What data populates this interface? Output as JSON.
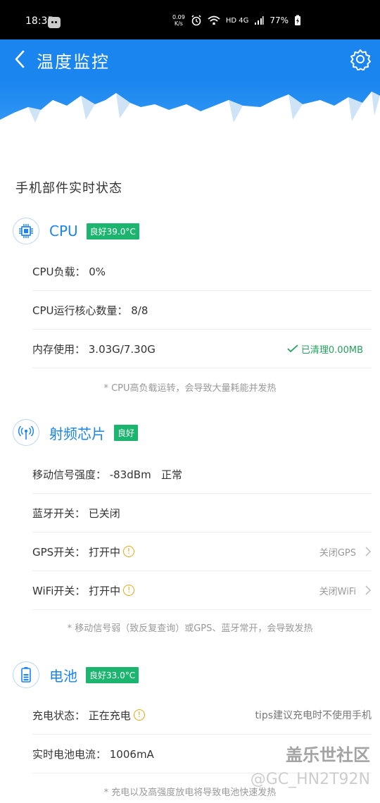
{
  "status_bar": {
    "time": "18:35",
    "speed_top": "0.09",
    "speed_bottom": "K/s",
    "network": "HD 4G",
    "battery": "77%"
  },
  "app_bar": {
    "title": "温度监控"
  },
  "section_heading": "手机部件实时状态",
  "cpu": {
    "title": "CPU",
    "badge": "良好39.0°C",
    "rows": [
      {
        "label": "CPU负载： 0%"
      },
      {
        "label": "CPU运行核心数量： 8/8"
      },
      {
        "label": "内存使用： 3.03G/7.30G",
        "action": "已清理0.00MB"
      }
    ],
    "note": "* CPU高负载运转，会导致大量耗能并发热"
  },
  "rf": {
    "title": "射频芯片",
    "badge": "良好",
    "rows": [
      {
        "label": "移动信号强度： -83dBm   正常"
      },
      {
        "label": "蓝牙开关： 已关闭"
      },
      {
        "label": "GPS开关： 打开中",
        "action": "关闭GPS"
      },
      {
        "label": "WiFi开关： 打开中",
        "action": "关闭WiFi"
      }
    ],
    "note": "* 移动信号弱（致反复查询）或GPS、蓝牙常开，会导致发热"
  },
  "battery": {
    "title": "电池",
    "badge": "良好33.0°C",
    "rows": [
      {
        "label": "充电状态： 正在充电",
        "tips": "tips建议充电时不使用手机"
      },
      {
        "label": "实时电池电流： 1006mA"
      }
    ],
    "note": "* 充电以及高强度放电将导致电池快速发热"
  },
  "watermark": {
    "line1": "盖乐世社区",
    "line2": "@GC_HN2T92N"
  },
  "colors": {
    "accent": "#1a84ef",
    "good": "#1bb56f",
    "warn": "#e6a817",
    "cleaned": "#23a25c"
  }
}
